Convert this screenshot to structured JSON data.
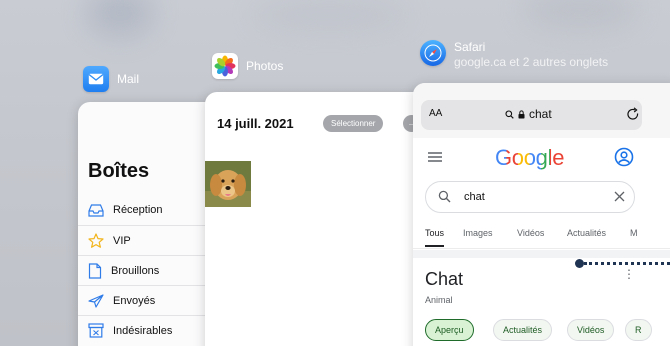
{
  "colors": {
    "wallpaper": "#c6c9cf",
    "mail_icon": "#2f8ef5",
    "safari_icon": "#1d7cf2",
    "chip_accent": "#1e6b2a",
    "annotation": "#1f3352"
  },
  "mail": {
    "app_name": "Mail",
    "icon": "mail-envelope-icon",
    "title": "Boîtes",
    "items": [
      {
        "label": "Réception",
        "icon": "inbox-tray-icon"
      },
      {
        "label": "VIP",
        "icon": "star-icon"
      },
      {
        "label": "Brouillons",
        "icon": "draft-document-icon"
      },
      {
        "label": "Envoyés",
        "icon": "paper-plane-icon"
      },
      {
        "label": "Indésirables",
        "icon": "junk-bin-icon"
      }
    ]
  },
  "photos": {
    "app_name": "Photos",
    "icon": "photos-flower-icon",
    "date": "14 juill. 2021",
    "select_label": "Sélectionner",
    "more_label": "···"
  },
  "safari": {
    "app_name": "Safari",
    "subtitle": "google.ca et 2 autres onglets",
    "icon": "compass-icon",
    "url_aa": "AA",
    "url_text": "chat",
    "google_logo": "Google",
    "search_query": "chat",
    "tabs": [
      "Tous",
      "Images",
      "Vidéos",
      "Actualités",
      "M"
    ],
    "kp_title": "Chat",
    "kp_sub": "Animal",
    "kp_more": "⋮",
    "chips": [
      "Aperçu",
      "Actualités",
      "Vidéos",
      "R"
    ]
  }
}
